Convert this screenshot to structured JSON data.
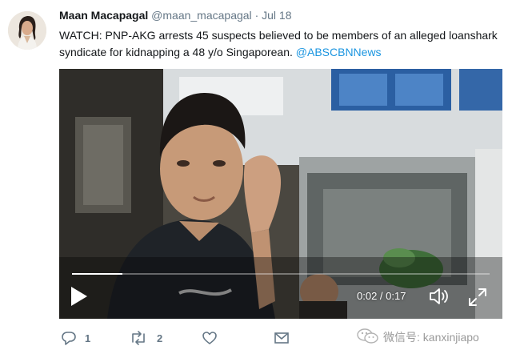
{
  "tweet": {
    "author_name": "Maan Macapagal",
    "author_handle": "@maan_macapagal",
    "separator": "·",
    "date": "Jul 18",
    "text": "WATCH: PNP-AKG arrests 45 suspects believed to be members of an alleged loanshark syndicate for kidnapping a 48 y/o Singaporean.",
    "mention": "@ABSCBNNews"
  },
  "video": {
    "time_display": "0:02 / 0:17",
    "progress": 0.12
  },
  "actions": {
    "reply_count": "1",
    "retweet_count": "2"
  },
  "watermark": {
    "text": "微信号: kanxinjiapo"
  },
  "icons": {
    "reply": "reply-icon",
    "retweet": "retweet-icon",
    "like": "heart-icon",
    "message": "envelope-icon",
    "play": "play-icon",
    "volume": "volume-icon",
    "fullscreen": "fullscreen-icon",
    "wechat": "wechat-icon"
  },
  "colors": {
    "link": "#1b95e0",
    "muted": "#657786",
    "text": "#14171a"
  }
}
